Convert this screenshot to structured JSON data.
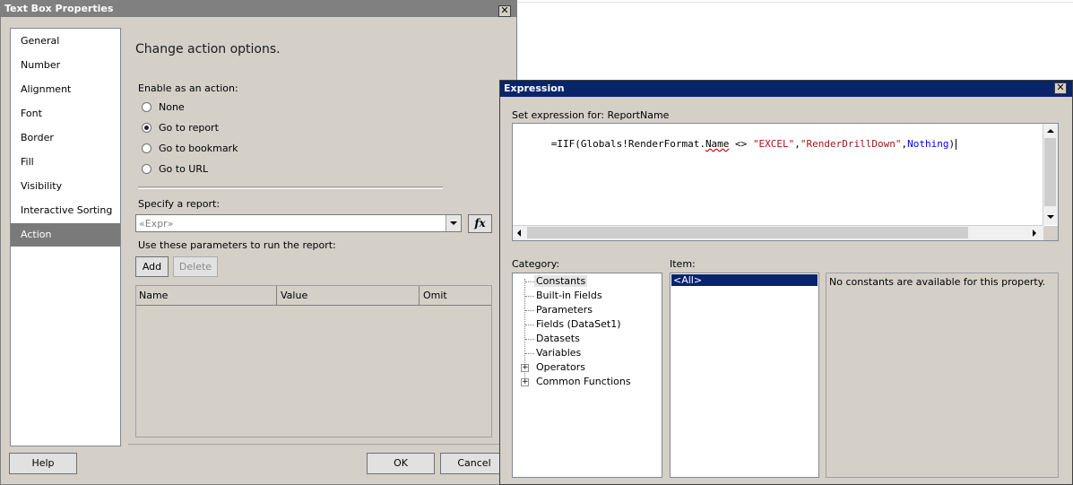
{
  "tbp": {
    "title": "Text Box Properties",
    "close": "✕",
    "nav": [
      "General",
      "Number",
      "Alignment",
      "Font",
      "Border",
      "Fill",
      "Visibility",
      "Interactive Sorting",
      "Action"
    ],
    "heading": "Change action options.",
    "enable_label": "Enable as an action:",
    "radios": [
      "None",
      "Go to report",
      "Go to bookmark",
      "Go to URL"
    ],
    "specify_label": "Specify a report:",
    "report_value": "«Expr»",
    "fx": "fx",
    "params_label": "Use these parameters to run the report:",
    "add": "Add",
    "delete": "Delete",
    "columns": [
      "Name",
      "Value",
      "Omit"
    ],
    "help": "Help",
    "ok": "OK",
    "cancel": "Cancel"
  },
  "expr": {
    "title": "Expression",
    "close": "✕",
    "set_label": "Set expression for: ReportName",
    "code": {
      "p1": "=IIF(Globals!RenderFormat.",
      "p2": "Name",
      "p3": " <> ",
      "p4": "\"EXCEL\"",
      "p5": ",",
      "p6": "\"RenderDrillDown\"",
      "p7": ",",
      "p8": "Nothing",
      "p9": ")"
    },
    "category_label": "Category:",
    "categories": [
      "Constants",
      "Built-in Fields",
      "Parameters",
      "Fields (DataSet1)",
      "Datasets",
      "Variables",
      "Operators",
      "Common Functions"
    ],
    "item_label": "Item:",
    "item_selected": "<All>",
    "description": "No constants are available for this property."
  },
  "colors": {
    "title_active": "#0a246a",
    "title_inactive": "#808080",
    "dialog_bg": "#d4d0c8",
    "selection": "#0a246a",
    "string_literal": "#a31515",
    "keyword": "#0000ff"
  }
}
